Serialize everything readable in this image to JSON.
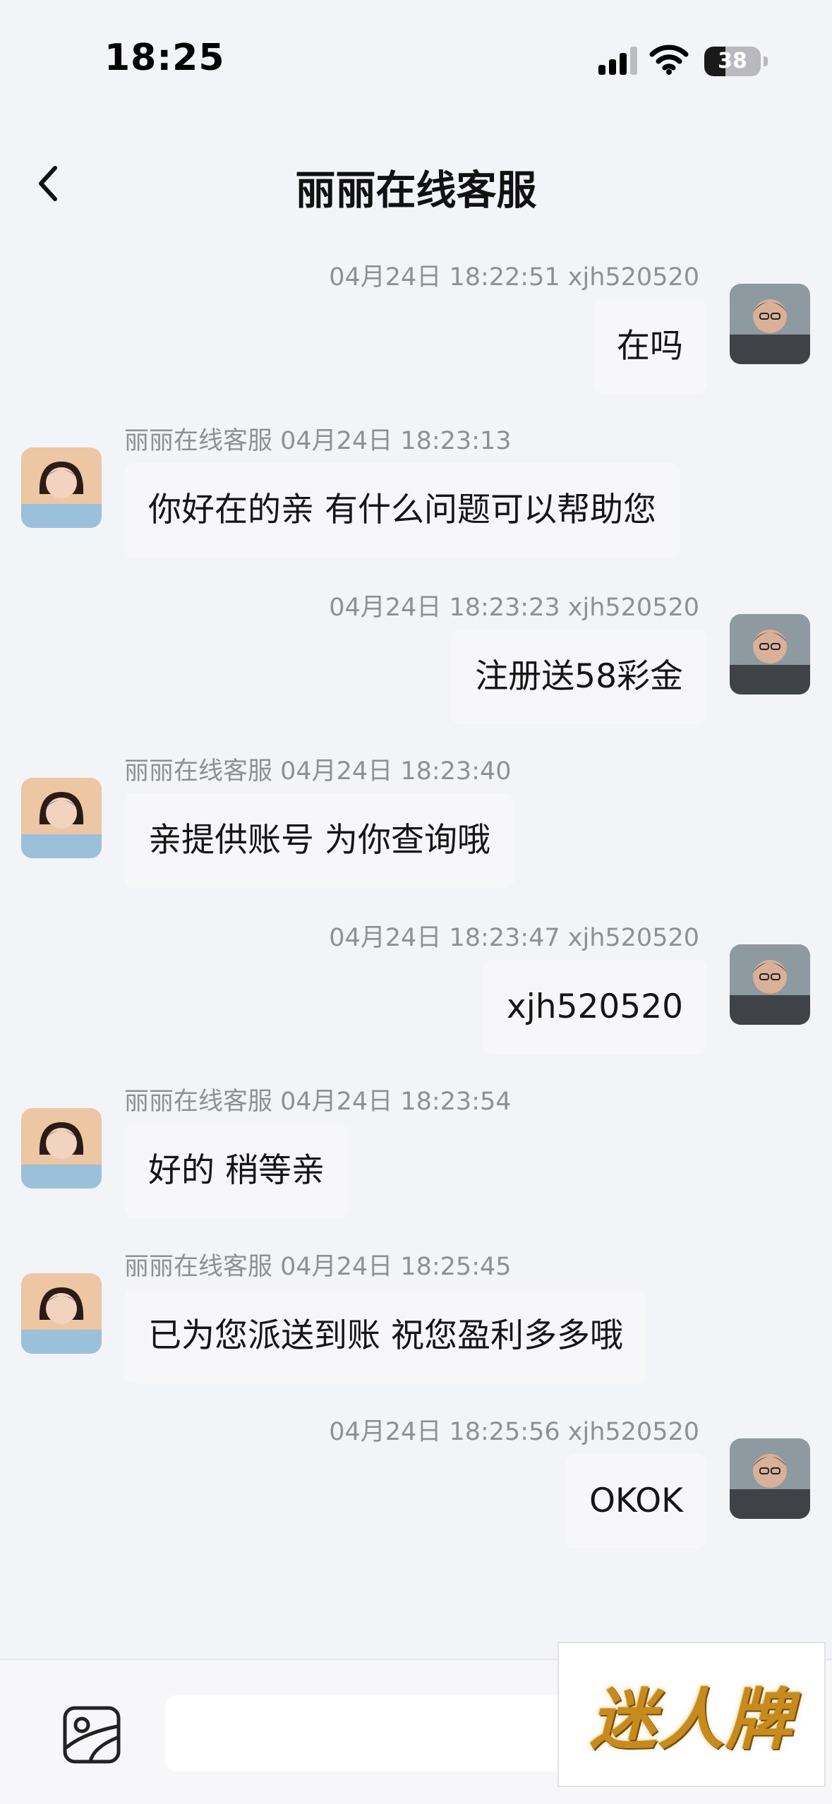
{
  "status_bar": {
    "time": "18:25",
    "battery": "38",
    "battery_level": 0.38
  },
  "header": {
    "title": "丽丽在线客服"
  },
  "messages": [
    {
      "direction": "out",
      "meta": "04月24日 18:22:51 xjh520520",
      "text": "在吗"
    },
    {
      "direction": "in",
      "meta": "丽丽在线客服 04月24日 18:23:13",
      "text": "你好在的亲 有什么问题可以帮助您"
    },
    {
      "direction": "out",
      "meta": "04月24日 18:23:23 xjh520520",
      "text": "注册送58彩金"
    },
    {
      "direction": "in",
      "meta": "丽丽在线客服 04月24日 18:23:40",
      "text": "亲提供账号 为你查询哦"
    },
    {
      "direction": "out",
      "meta": "04月24日 18:23:47 xjh520520",
      "text": "xjh520520"
    },
    {
      "direction": "in",
      "meta": "丽丽在线客服 04月24日 18:23:54",
      "text": "好的 稍等亲"
    },
    {
      "direction": "in",
      "meta": "丽丽在线客服 04月24日 18:25:45",
      "text": "已为您派送到账 祝您盈利多多哦"
    },
    {
      "direction": "out",
      "meta": "04月24日 18:25:56 xjh520520",
      "text": "OKOK"
    }
  ],
  "input": {
    "placeholder": ""
  },
  "watermark": {
    "text": "迷人牌"
  },
  "icons": {
    "back": "chevron-left-icon",
    "image": "image-picker-icon"
  },
  "colors": {
    "background": "#f3f4f8",
    "bubble": "#f7f7f9",
    "meta_text": "#8f9094",
    "watermark_gold": "#c68a1d"
  }
}
